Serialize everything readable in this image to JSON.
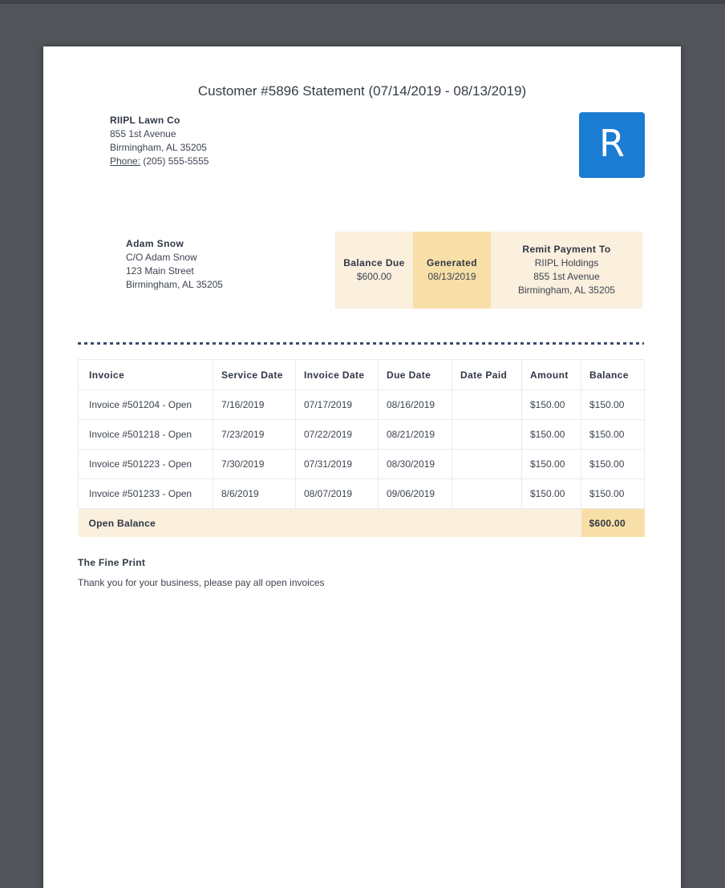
{
  "doc": {
    "title": "Customer #5896 Statement (07/14/2019 - 08/13/2019)"
  },
  "company": {
    "name": "RIIPL Lawn Co",
    "address_line1": "855 1st Avenue",
    "address_line2": "Birmingham, AL 35205",
    "phone_label": "Phone:",
    "phone_value": " (205) 555-5555"
  },
  "logo": {
    "letter": "R",
    "color": "#1b7cd3"
  },
  "customer": {
    "name": "Adam Snow",
    "line1": "C/O Adam Snow",
    "line2": "123 Main Street",
    "line3": "Birmingham, AL 35205"
  },
  "summary": {
    "balance_due_label": "Balance Due",
    "balance_due_value": "$600.00",
    "generated_label": "Generated",
    "generated_value": "08/13/2019",
    "remit_label": "Remit Payment To",
    "remit_line1": "RIIPL Holdings",
    "remit_line2": "855 1st Avenue",
    "remit_line3": "Birmingham, AL 35205"
  },
  "table": {
    "headers": [
      "Invoice",
      "Service Date",
      "Invoice Date",
      "Due Date",
      "Date Paid",
      "Amount",
      "Balance"
    ],
    "rows": [
      [
        "Invoice #501204 - Open",
        "7/16/2019",
        "07/17/2019",
        "08/16/2019",
        "",
        "$150.00",
        "$150.00"
      ],
      [
        "Invoice #501218 - Open",
        "7/23/2019",
        "07/22/2019",
        "08/21/2019",
        "",
        "$150.00",
        "$150.00"
      ],
      [
        "Invoice #501223 - Open",
        "7/30/2019",
        "07/31/2019",
        "08/30/2019",
        "",
        "$150.00",
        "$150.00"
      ],
      [
        "Invoice #501233 - Open",
        "8/6/2019",
        "08/07/2019",
        "09/06/2019",
        "",
        "$150.00",
        "$150.00"
      ]
    ],
    "footer_label": "Open Balance",
    "footer_value": "$600.00"
  },
  "fine_print": {
    "heading": "The Fine Print",
    "text": "Thank you for your business, please pay all open invoices"
  },
  "colors": {
    "backdrop": "#515559",
    "peach_light": "#fbefdd",
    "peach_dark": "#f8dfa7",
    "logo_blue": "#1b7cd3",
    "dotted_line": "#3e4a6d"
  }
}
